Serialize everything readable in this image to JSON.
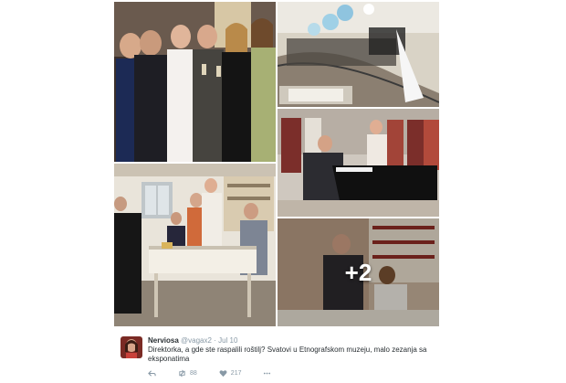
{
  "media": {
    "more_count": "+2",
    "photos": [
      {
        "name": "photo-toast"
      },
      {
        "name": "photo-stairs-guests"
      },
      {
        "name": "photo-piano"
      },
      {
        "name": "photo-table-signing"
      },
      {
        "name": "photo-more"
      }
    ]
  },
  "tweet": {
    "author_name": "Nerviosa",
    "author_handle": "@vagax2",
    "separator": "·",
    "time": "Jul 10",
    "text": "Direktorka, a gde ste raspalili roštilj? Svatovi u Etnografskom muzeju, malo zezanja sa eksponatima",
    "actions": {
      "reply_icon": "reply-icon",
      "retweet_icon": "retweet-icon",
      "retweet_count": "88",
      "like_icon": "heart-icon",
      "like_count": "217",
      "more_icon": "more-dots-icon"
    }
  },
  "colors": {
    "text_primary": "#292f33",
    "text_secondary": "#8899a6"
  }
}
